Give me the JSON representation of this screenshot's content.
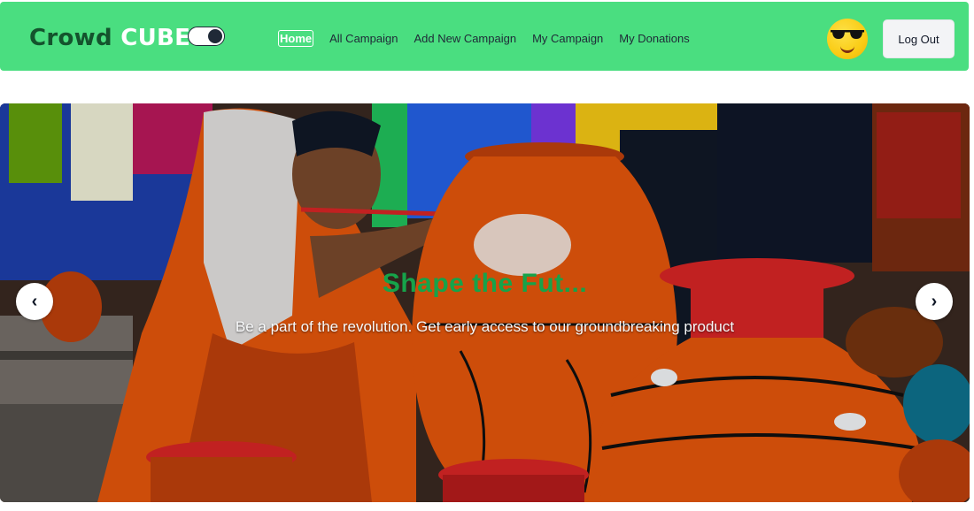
{
  "navbar": {
    "brand_part1": "Crowd",
    "brand_part2": "CUBE",
    "theme_toggle_state": "dark",
    "links": [
      {
        "label": "Home",
        "active": true
      },
      {
        "label": "All Campaign",
        "active": false
      },
      {
        "label": "Add New Campaign",
        "active": false
      },
      {
        "label": "My Campaign",
        "active": false
      },
      {
        "label": "My Donations",
        "active": false
      }
    ],
    "avatar_icon": "sunglasses-emoji-icon",
    "logout_label": "Log Out"
  },
  "carousel": {
    "title": "Shape the Fut...",
    "subtitle": "Be a part of the revolution. Get early access to our groundbreaking product",
    "prev_icon": "‹",
    "next_icon": "›"
  },
  "colors": {
    "navbar_bg": "#4ade80",
    "brand_dark": "#14532d",
    "title_green": "#16a34a"
  }
}
